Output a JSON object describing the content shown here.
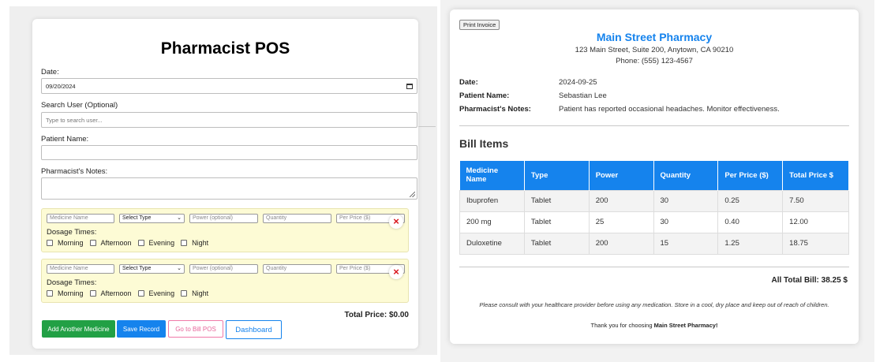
{
  "pos": {
    "title": "Pharmacist POS",
    "date_label": "Date:",
    "date_value": "09/20/2024",
    "search_label": "Search User (Optional)",
    "search_placeholder": "Type to search user...",
    "patient_label": "Patient Name:",
    "patient_value": "",
    "notes_label": "Pharmacist's Notes:",
    "notes_value": "",
    "medicine_rows": [
      {
        "name_placeholder": "Medicine Name",
        "type_value": "Select Type",
        "power_placeholder": "Power (optional)",
        "quantity_placeholder": "Quantity",
        "price_placeholder": "Per Price ($)",
        "dosage_label": "Dosage Times:",
        "times": [
          "Morning",
          "Afternoon",
          "Evening",
          "Night"
        ]
      },
      {
        "name_placeholder": "Medicine Name",
        "type_value": "Select Type",
        "power_placeholder": "Power (optional)",
        "quantity_placeholder": "Quantity",
        "price_placeholder": "Per Price ($)",
        "dosage_label": "Dosage Times:",
        "times": [
          "Morning",
          "Afternoon",
          "Evening",
          "Night"
        ]
      }
    ],
    "remove_icon": "×",
    "total_price": "Total Price: $0.00",
    "buttons": {
      "add": "Add Another Medicine",
      "save": "Save Record",
      "bill": "Go to Bill POS",
      "dashboard": "Dashboard"
    }
  },
  "invoice": {
    "print_label": "Print Invoice",
    "pharmacy_name": "Main Street Pharmacy",
    "address": "123 Main Street, Suite 200, Anytown, CA 90210",
    "phone": "Phone: (555) 123-4567",
    "info": [
      {
        "label": "Date:",
        "value": "2024-09-25"
      },
      {
        "label": "Patient Name:",
        "value": "Sebastian Lee"
      },
      {
        "label": "Pharmacist's Notes:",
        "value": "Patient has reported occasional headaches. Monitor effectiveness."
      }
    ],
    "bill_title": "Bill Items",
    "table": {
      "headers": [
        "Medicine Name",
        "Type",
        "Power",
        "Quantity",
        "Per Price ($)",
        "Total Price $"
      ],
      "rows": [
        [
          "Ibuprofen",
          "Tablet",
          "200",
          "30",
          "0.25",
          "7.50"
        ],
        [
          "200 mg",
          "Tablet",
          "25",
          "30",
          "0.40",
          "12.00"
        ],
        [
          "Duloxetine",
          "Tablet",
          "200",
          "15",
          "1.25",
          "18.75"
        ]
      ]
    },
    "all_total": "All Total Bill: 38.25 $",
    "footer_note": "Please consult with your healthcare provider before using any medication. Store in a cool, dry place and keep out of reach of children.",
    "thanks_prefix": "Thank you for choosing ",
    "thanks_name": "Main Street Pharmacy!"
  },
  "colors": {
    "accent_blue": "#1583ed",
    "green": "#22a045",
    "pink": "#f07aa8",
    "med_block_bg": "#fdfbd5",
    "remove_red": "#d9161c"
  }
}
